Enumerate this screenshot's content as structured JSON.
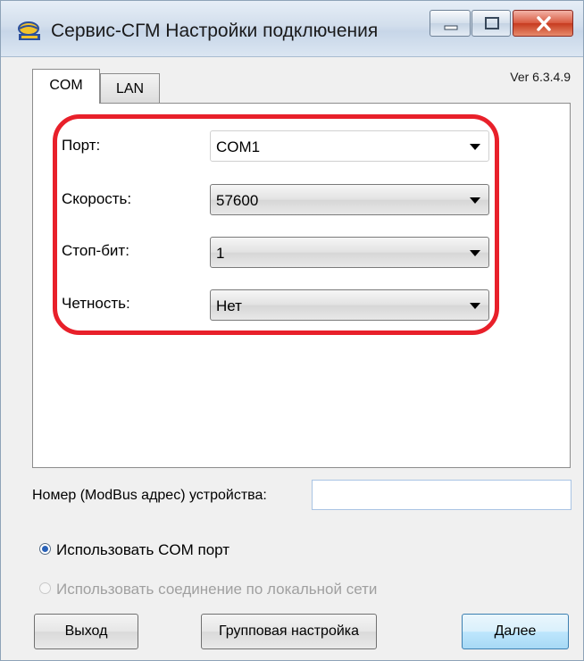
{
  "window": {
    "title": "Сервис-СГМ Настройки подключения",
    "icon": "app-logo-icon"
  },
  "version": "Ver 6.3.4.9",
  "tabs": [
    {
      "label": "COM",
      "active": true
    },
    {
      "label": "LAN",
      "active": false
    }
  ],
  "com_settings": {
    "port": {
      "label": "Порт:",
      "value": "COM1"
    },
    "speed": {
      "label": "Скорость:",
      "value": "57600"
    },
    "stop_bits": {
      "label": "Стоп-бит:",
      "value": "1"
    },
    "parity": {
      "label": "Четность:",
      "value": "Нет"
    }
  },
  "device_address": {
    "label": "Номер (ModBus адрес) устройства:",
    "value": ""
  },
  "connection_mode": {
    "use_com": {
      "label": "Использовать COM порт",
      "checked": true,
      "enabled": true
    },
    "use_lan": {
      "label": "Использовать соединение по локальной сети",
      "checked": false,
      "enabled": false
    }
  },
  "buttons": {
    "exit": "Выход",
    "group_setup": "Групповая настройка",
    "next": "Далее"
  },
  "colors": {
    "highlight": "#e8202a",
    "default_button": "#3c7fb1"
  }
}
